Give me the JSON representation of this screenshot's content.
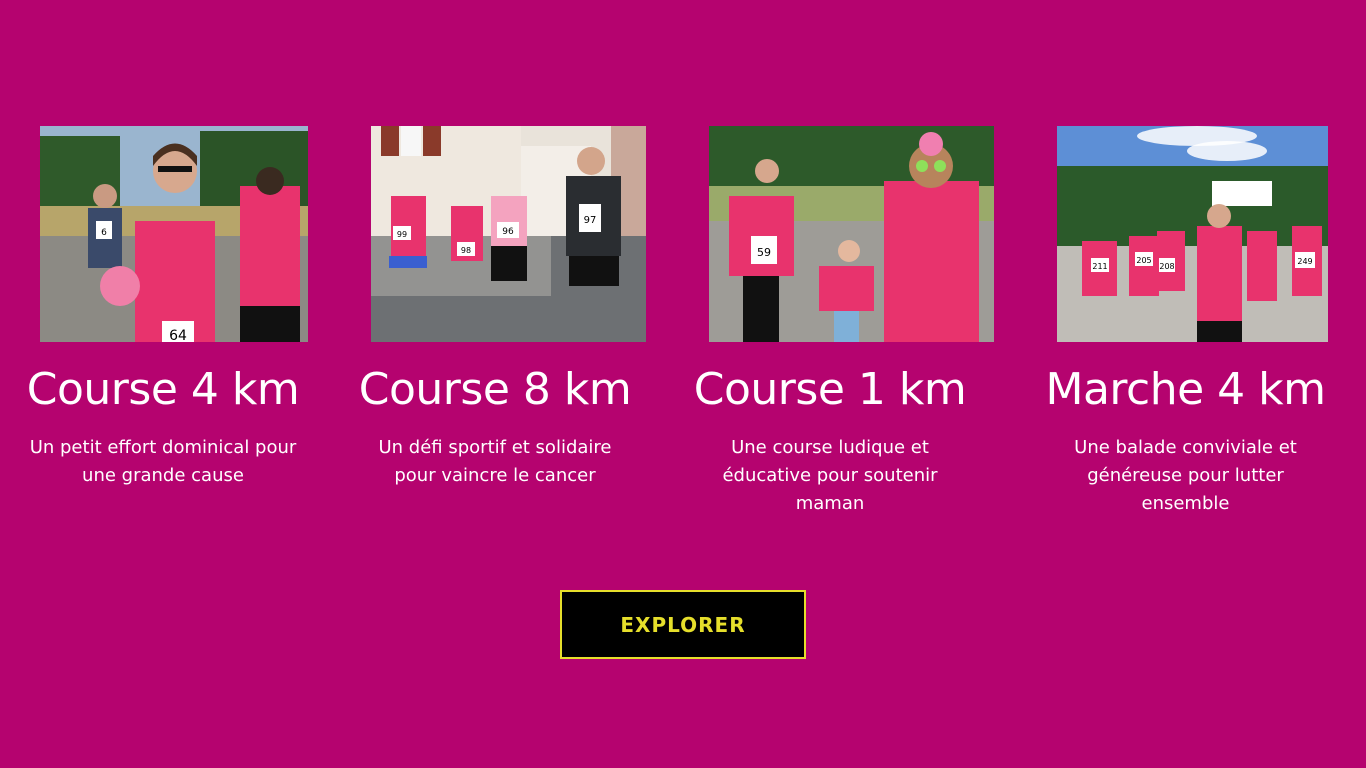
{
  "events": [
    {
      "title": "Course 4 km",
      "description": "Un petit effort dominical pour une grande cause",
      "photo_alt": "Runner in pink t-shirt smiling with bib number",
      "bibs": [
        "6",
        "64"
      ]
    },
    {
      "title": "Course 8 km",
      "description": "Un défi sportif et solidaire pour vaincre le cancer",
      "photo_alt": "Runners on a street",
      "bibs": [
        "99",
        "98",
        "96",
        "97"
      ]
    },
    {
      "title": "Course 1 km",
      "description": "Une course ludique et éducative pour soutenir maman",
      "photo_alt": "Woman, child and costumed walker",
      "bibs": [
        "59"
      ]
    },
    {
      "title": "Marche 4 km",
      "description": "Une balade conviviale et généreuse pour lutter ensemble",
      "photo_alt": "Group of walkers in pink t-shirts",
      "bibs": [
        "211",
        "205",
        "208",
        "249"
      ]
    }
  ],
  "cta": {
    "label": "EXPLORER"
  },
  "colors": {
    "background": "#b5036f",
    "button_bg": "#000000",
    "button_text": "#e6df2b",
    "shirt_pink": "#e8336d"
  }
}
